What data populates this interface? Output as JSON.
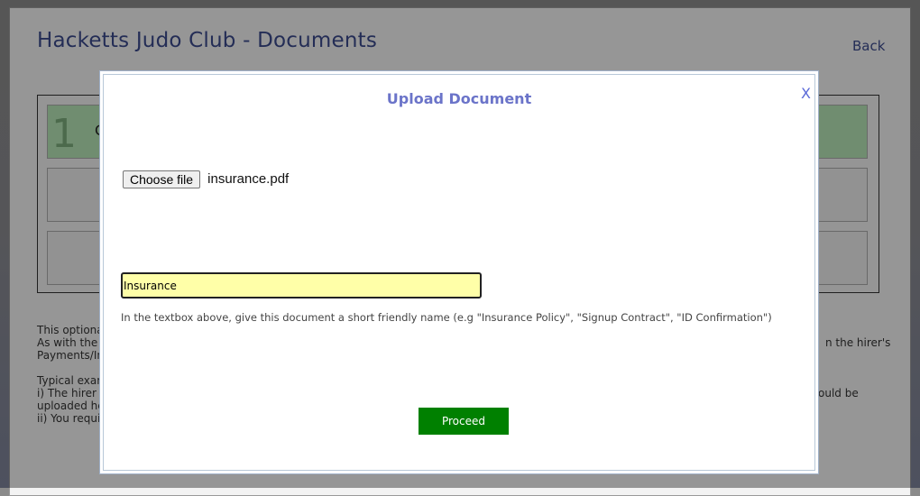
{
  "page": {
    "title": "Hacketts Judo Club - Documents",
    "back_label": "Back"
  },
  "steps": {
    "first_number": "1",
    "first_label_fragment": "C"
  },
  "background_text": {
    "line1": "This optiona",
    "line2": "As with the N",
    "line2_right": "n the hirer's",
    "line3": "Payments/In",
    "line4": "Typical exam",
    "line5": "i) The hirer h",
    "line5_right": "ould be",
    "line6": "uploaded he",
    "line7": "ii) You requir"
  },
  "modal": {
    "title": "Upload Document",
    "close_label": "X",
    "choose_file_label": "Choose file",
    "file_name": "insurance.pdf",
    "name_input_value": "Insurance",
    "hint": "In the textbox above, give this document a short friendly name (e.g \"Insurance Policy\", \"Signup Contract\", \"ID Confirmation\")",
    "proceed_label": "Proceed"
  },
  "colors": {
    "title": "#3b4a8c",
    "modal_title": "#6b74c9",
    "proceed": "#008000",
    "input_bg": "#ffffa8"
  }
}
